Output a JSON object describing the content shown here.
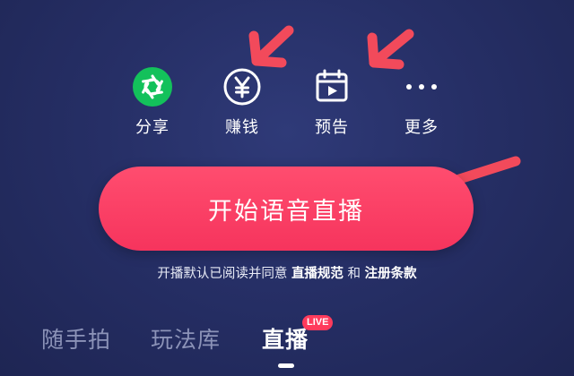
{
  "actions": [
    {
      "key": "share",
      "label": "分享",
      "icon": "share-icon",
      "icon_bg": "#13c15b"
    },
    {
      "key": "earn",
      "label": "赚钱",
      "icon": "yen-coin-icon"
    },
    {
      "key": "preview",
      "label": "预告",
      "icon": "calendar-play-icon"
    },
    {
      "key": "more",
      "label": "更多",
      "icon": "more-dots-icon"
    }
  ],
  "start_button": {
    "label": "开始语音直播",
    "color": "#f6345d"
  },
  "agreement": {
    "prefix": "开播默认已阅读并同意 ",
    "link1": "直播规范",
    "middle": " 和 ",
    "link2": "注册条款"
  },
  "tabs": {
    "items": [
      {
        "label": "随手拍",
        "active": false
      },
      {
        "label": "玩法库",
        "active": false
      },
      {
        "label": "直播",
        "active": true
      }
    ],
    "live_badge": "LIVE"
  },
  "annotation_color": "#f24a5b",
  "background": "#262f66"
}
